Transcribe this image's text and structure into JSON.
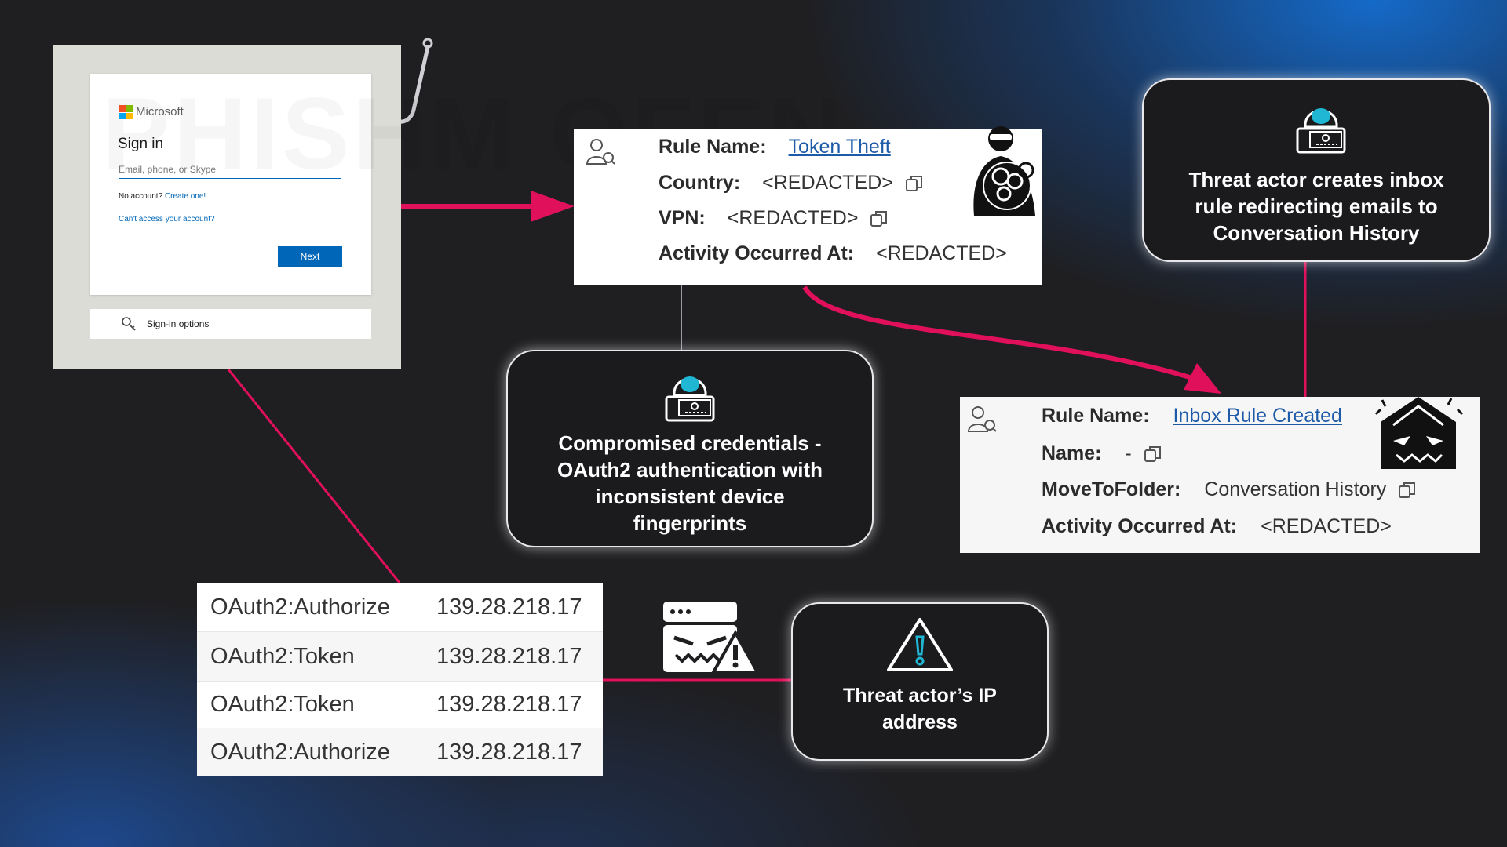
{
  "signin": {
    "brand": "Microsoft",
    "title": "Sign in",
    "email_placeholder": "Email, phone, or Skype",
    "no_account": "No account?",
    "create_link": "Create one!",
    "cant_access": "Can't access your account?",
    "next_label": "Next",
    "signin_options": "Sign-in options",
    "watermark": "PHISHM OFEN",
    "logo_colors": [
      "#f25022",
      "#7fba00",
      "#00a4ef",
      "#ffb900"
    ]
  },
  "token_rule": {
    "rule_name_key": "Rule Name:",
    "rule_name_value": "Token Theft",
    "country_key": "Country:",
    "country_value": "<REDACTED>",
    "vpn_key": "VPN:",
    "vpn_value": "<REDACTED>",
    "activity_key": "Activity Occurred At:",
    "activity_value": "<REDACTED>"
  },
  "inbox_rule": {
    "rule_name_key": "Rule Name:",
    "rule_name_value": "Inbox Rule Created",
    "name_key": "Name:",
    "name_value": "-",
    "folder_key": "MoveToFolder:",
    "folder_value": "Conversation History",
    "activity_key": "Activity Occurred At:",
    "activity_value": "<REDACTED>"
  },
  "callouts": {
    "inbox_rule_text": "Threat actor creates inbox rule redirecting emails to Conversation History",
    "credentials_text": "Compromised credentials - OAuth2 authentication with inconsistent device fingerprints",
    "ip_text": "Threat actor’s IP address"
  },
  "oauth_log": [
    {
      "operation": "OAuth2:Authorize",
      "ip": "139.28.218.17"
    },
    {
      "operation": "OAuth2:Token",
      "ip": "139.28.218.17"
    },
    {
      "operation": "OAuth2:Token",
      "ip": "139.28.218.17"
    },
    {
      "operation": "OAuth2:Authorize",
      "ip": "139.28.218.17"
    }
  ],
  "colors": {
    "connector": "#e0105a",
    "link": "#1d5aa8",
    "accent_cyan": "#1fb7d4",
    "ms_blue": "#0067b8"
  },
  "icons": [
    "fish-hook-icon",
    "user-avatar-icon",
    "thief-icon",
    "hacker-icon",
    "server-malware-icon",
    "warning-icon",
    "copy-icon",
    "malicious-email-icon",
    "search-key-icon"
  ]
}
